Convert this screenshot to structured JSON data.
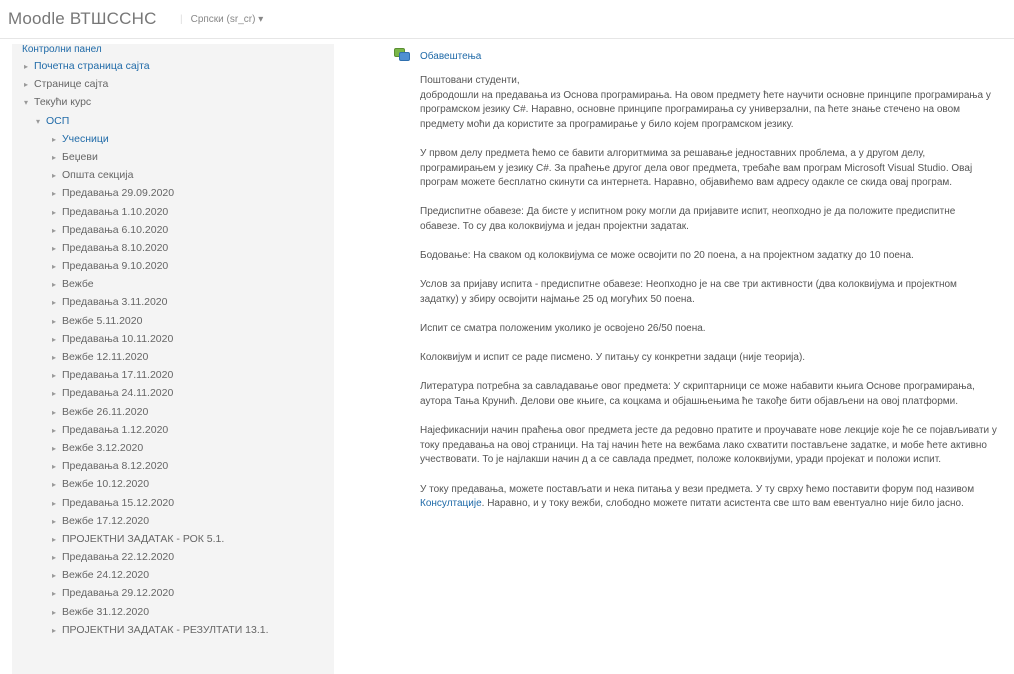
{
  "header": {
    "brand": "Moodle ВТШССНС",
    "language": "Српски (sr_cr) ▾"
  },
  "sidebar": {
    "heading": "Контролни панел",
    "items": [
      {
        "label": "Почетна страница сајта",
        "arrow": "▸",
        "level": 0,
        "style": "link"
      },
      {
        "label": "Странице сајта",
        "arrow": "▸",
        "level": 0,
        "style": "plain"
      },
      {
        "label": "Текући курс",
        "arrow": "▾",
        "level": 0,
        "style": "plain"
      },
      {
        "label": "ОСП",
        "arrow": "▾",
        "level": 1,
        "style": "course"
      },
      {
        "label": "Учесници",
        "arrow": "▸",
        "level": 2,
        "style": "cur"
      },
      {
        "label": "Беџеви",
        "arrow": "▸",
        "level": 2,
        "style": "plain"
      },
      {
        "label": "Општа секција",
        "arrow": "▸",
        "level": 2,
        "style": "plain"
      },
      {
        "label": "Предавања 29.09.2020",
        "arrow": "▸",
        "level": 2,
        "style": "plain"
      },
      {
        "label": "Предавања 1.10.2020",
        "arrow": "▸",
        "level": 2,
        "style": "plain"
      },
      {
        "label": "Предавања 6.10.2020",
        "arrow": "▸",
        "level": 2,
        "style": "plain"
      },
      {
        "label": "Предавања 8.10.2020",
        "arrow": "▸",
        "level": 2,
        "style": "plain"
      },
      {
        "label": "Предавања 9.10.2020",
        "arrow": "▸",
        "level": 2,
        "style": "plain"
      },
      {
        "label": "Вежбе",
        "arrow": "▸",
        "level": 2,
        "style": "plain"
      },
      {
        "label": "Предавања 3.11.2020",
        "arrow": "▸",
        "level": 2,
        "style": "plain"
      },
      {
        "label": "Вежбе 5.11.2020",
        "arrow": "▸",
        "level": 2,
        "style": "plain"
      },
      {
        "label": "Предавања 10.11.2020",
        "arrow": "▸",
        "level": 2,
        "style": "plain"
      },
      {
        "label": "Вежбе 12.11.2020",
        "arrow": "▸",
        "level": 2,
        "style": "plain"
      },
      {
        "label": "Предавања 17.11.2020",
        "arrow": "▸",
        "level": 2,
        "style": "plain"
      },
      {
        "label": "Предавања 24.11.2020",
        "arrow": "▸",
        "level": 2,
        "style": "plain"
      },
      {
        "label": "Вежбе 26.11.2020",
        "arrow": "▸",
        "level": 2,
        "style": "plain"
      },
      {
        "label": "Предавања 1.12.2020",
        "arrow": "▸",
        "level": 2,
        "style": "plain"
      },
      {
        "label": "Вежбе 3.12.2020",
        "arrow": "▸",
        "level": 2,
        "style": "plain"
      },
      {
        "label": "Предавања 8.12.2020",
        "arrow": "▸",
        "level": 2,
        "style": "plain"
      },
      {
        "label": "Вежбе 10.12.2020",
        "arrow": "▸",
        "level": 2,
        "style": "plain"
      },
      {
        "label": "Предавања 15.12.2020",
        "arrow": "▸",
        "level": 2,
        "style": "plain"
      },
      {
        "label": "Вежбе 17.12.2020",
        "arrow": "▸",
        "level": 2,
        "style": "plain"
      },
      {
        "label": "ПРОЈЕКТНИ ЗАДАТАК - РОК 5.1.",
        "arrow": "▸",
        "level": 2,
        "style": "plain"
      },
      {
        "label": "Предавања 22.12.2020",
        "arrow": "▸",
        "level": 2,
        "style": "plain"
      },
      {
        "label": "Вежбе 24.12.2020",
        "arrow": "▸",
        "level": 2,
        "style": "plain"
      },
      {
        "label": "Предавања 29.12.2020",
        "arrow": "▸",
        "level": 2,
        "style": "plain"
      },
      {
        "label": "Вежбе 31.12.2020",
        "arrow": "▸",
        "level": 2,
        "style": "plain"
      },
      {
        "label": "ПРОЈЕКТНИ ЗАДАТАК - РЕЗУЛТАТИ 13.1.",
        "arrow": "▸",
        "level": 2,
        "style": "plain"
      }
    ]
  },
  "main": {
    "forum_icon": "forum-icon",
    "forum_title": "Обавештења",
    "paragraphs": [
      "Поштовани студенти,\nдобродошли на предавања из Основа програмирања. На овом предмету ћете научити основне принципе програмирања у програмском језику C#. Наравно, основне принципе програмирања су универзални, па ћете знање стечено на овом предмету моћи да користите за програмирање у било којем програмском језику.",
      "У првом делу предмета ћемо се бавити алгоритмима за решавање једноставних проблема, а у другом делу, програмирањем у језику C#. За праћење другог дела овог предмета, требаће вам програм Microsoft Visual Studio. Овај програм можете бесплатно скинути са интернета. Наравно, објавићемо вам адресу одакле се скида овај програм.",
      "Предиспитне обавезе: Да бисте у испитном року могли да пријавите испит, неопходно је да положите предиспитне обавезе. То су два колоквијума и један пројектни задатак.",
      "Бодовање: На сваком од колоквијума се може освојити по 20 поена, а на пројектном задатку до 10 поена.",
      "Услов за пријаву испита - предиспитне обавезе: Неопходно је на све три активности (два колоквијума и пројектном задатку) у збиру освојити најмање 25 од могућих 50 поена.",
      "Испит се сматра положеним уколико је освојено 26/50 поена.",
      "Колоквијум и испит се раде писмено. У питању су конкретни задаци (није теорија).",
      "Литература потребна за савладавање овог предмета: У скриптарници се може набавити књига Основе програмирања, аутора Тања Крунић. Делови ове књиге, са коцкама и објашњењима ће такође бити објављени на овој платформи.",
      "Најефикаснији начин праћења овог предмета јесте да редовно пратите и проучавате нове лекције које ће се појављивати у току предавања на овој страници. На тај начин ћете на вежбама лако схватити постављене задатке, и мобе ћете активно учествовати. То је најлакши начин д а се савлада предмет, положе колоквијуми, уради пројекат и положи испит."
    ],
    "last_before": "У току предавања, можете постављати и нека питања у вези предмета. У ту сврху ћемо поставити форум под називом ",
    "last_link": "Консултације",
    "last_after": ". Наравно, и у току вежби, слободно можете питати асистента све што вам евентуално није било јасно."
  }
}
